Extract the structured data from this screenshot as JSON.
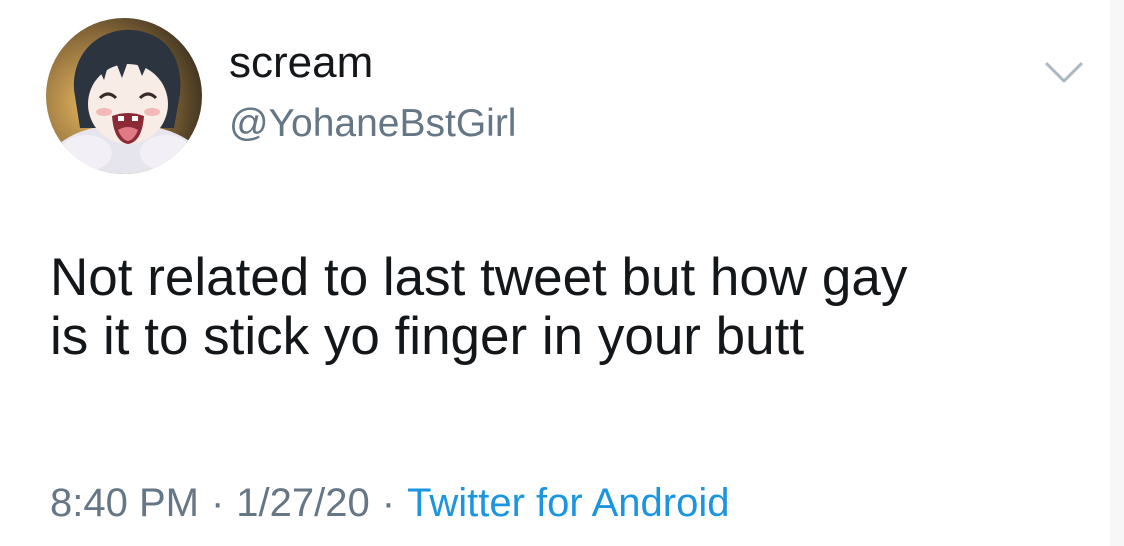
{
  "author": {
    "display_name": "scream",
    "handle": "@YohaneBstGirl",
    "avatar_icon": "anime-girl-avatar"
  },
  "menu": {
    "icon": "chevron-down-icon"
  },
  "tweet": {
    "text_lines": [
      "Not related to last tweet but how gay",
      "is it to stick yo finger in your butt"
    ]
  },
  "meta": {
    "time": "8:40 PM",
    "separator": "·",
    "date": "1/27/20",
    "source": "Twitter for Android"
  },
  "colors": {
    "text_primary": "#14171a",
    "text_secondary": "#657786",
    "link": "#1b95e0",
    "chevron": "#aab8c2"
  }
}
